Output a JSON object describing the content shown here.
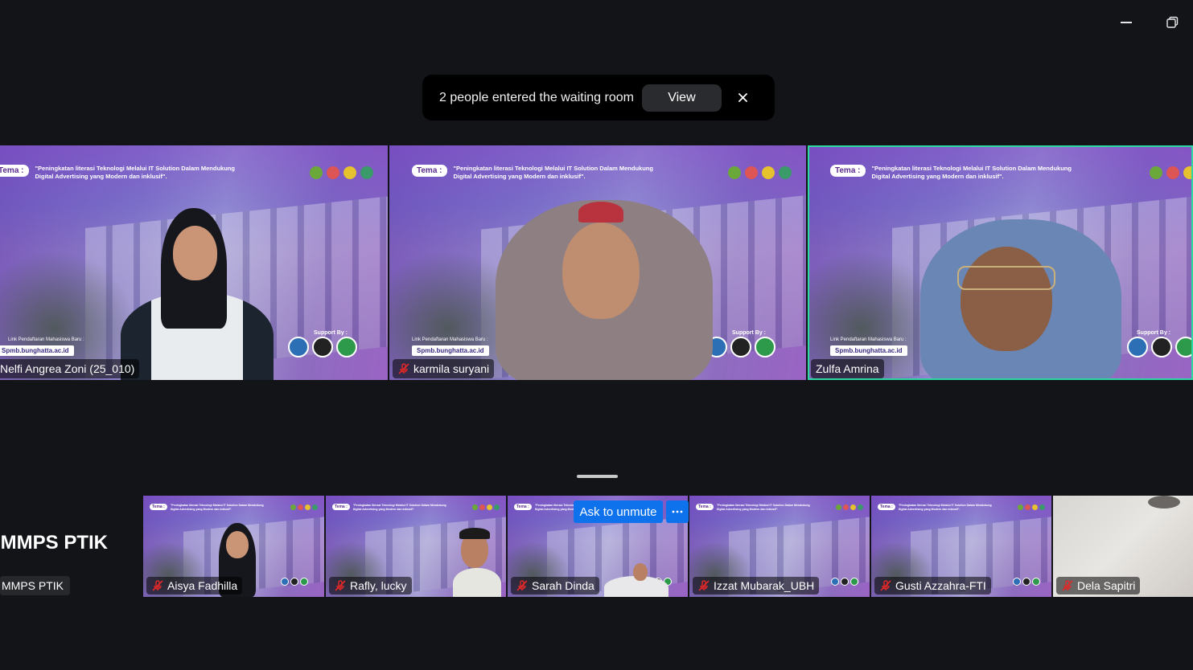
{
  "window": {
    "minimize_icon": "minimize-icon",
    "restore_icon": "restore-icon"
  },
  "toast": {
    "message": "2 people entered the waiting room",
    "view_label": "View",
    "close_icon": "close-icon"
  },
  "background_theme": {
    "tema": "Tema :",
    "title": "\"Peningkatan literasi Teknologi Melalui IT Solution Dalam Mendukung Digital Advertising yang Modern dan inklusif\".",
    "link_label": "Link Pendaftaran Mahasiswa Baru :",
    "link": "Spmb.bunghatta.ac.id",
    "support": "Support By :"
  },
  "main_tiles": [
    {
      "name": "Nelfi Angrea Zoni (25_010)",
      "muted": false
    },
    {
      "name": "karmila suryani",
      "muted": true
    },
    {
      "name": "Zulfa Amrina",
      "muted": false,
      "active_speaker": true
    }
  ],
  "strip": {
    "self_name_large": "IMMPS PTIK",
    "self_name_tag": "MMPS PTIK",
    "tiles": [
      {
        "name": "Aisya Fadhilla",
        "muted": true
      },
      {
        "name": "Rafly, lucky",
        "muted": true
      },
      {
        "name": "Sarah Dinda",
        "muted": true
      },
      {
        "name": "Izzat Mubarak_UBH",
        "muted": true
      },
      {
        "name": "Gusti Azzahra-FTI",
        "muted": true
      },
      {
        "name": "Dela Sapitri",
        "muted": true
      }
    ],
    "hover_actions": {
      "ask_to_unmute": "Ask to unmute",
      "more_icon": "more-icon"
    }
  },
  "colors": {
    "active_speaker_border": "#2ed8a3",
    "accent_blue": "#0e72ed",
    "muted_red": "#e02828"
  }
}
